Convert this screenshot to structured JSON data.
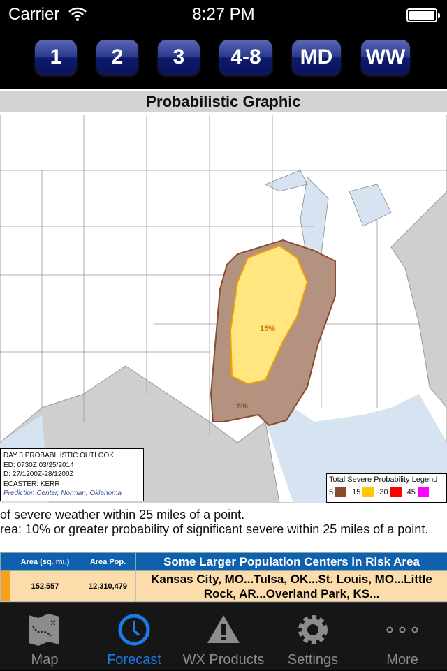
{
  "status": {
    "carrier": "Carrier",
    "time": "8:27 PM"
  },
  "days": [
    {
      "label": "1"
    },
    {
      "label": "2"
    },
    {
      "label": "3"
    },
    {
      "label": "4-8"
    },
    {
      "label": "MD"
    },
    {
      "label": "WW"
    }
  ],
  "title": "Probabilistic Graphic",
  "map": {
    "info": [
      "DAY 3 PROBABILISTIC OUTLOOK",
      "ED: 0730Z 03/25/2014",
      "D: 27/1200Z-28/1200Z",
      "ECASTER: KERR",
      "Prediction Center, Norman, Oklahoma"
    ],
    "labels": {
      "p15": "15%",
      "p5": "5%"
    },
    "legend": {
      "title": "Total Severe Probability Legend",
      "items": [
        {
          "v": "5",
          "c": "#8b4a2b"
        },
        {
          "v": "15",
          "c": "#ffc800"
        },
        {
          "v": "30",
          "c": "#ff0000"
        },
        {
          "v": "45",
          "c": "#ff00ff"
        }
      ]
    }
  },
  "text1": "of severe weather within 25 miles of a point.",
  "text2": "rea: 10% or greater probability of significant severe within 25 miles of a point.",
  "table": {
    "headers": [
      "Area (sq. mi.)",
      "Area Pop.",
      "Some Larger Population Centers in Risk Area"
    ],
    "row": [
      "152,557",
      "12,310,479",
      "Kansas City, MO...Tulsa, OK...St. Louis, MO...Little Rock, AR...Overland Park, KS..."
    ]
  },
  "tabs": [
    {
      "label": "Map",
      "icon": "map-icon"
    },
    {
      "label": "Forecast",
      "icon": "clock-icon"
    },
    {
      "label": "WX Products",
      "icon": "warning-icon"
    },
    {
      "label": "Settings",
      "icon": "gear-icon"
    },
    {
      "label": "More",
      "icon": "more-icon"
    }
  ],
  "colors": {
    "accent": "#1a7bea",
    "risk5": "#8b4a2b",
    "risk15": "#ffc800",
    "header": "#0f61ae"
  }
}
